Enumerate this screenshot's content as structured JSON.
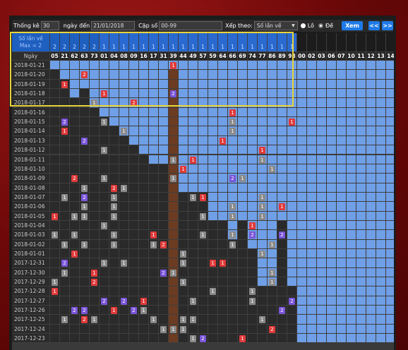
{
  "toolbar": {
    "thong_ke_label": "Thống kê",
    "thong_ke_value": "30",
    "ngay_den_label": "ngày đến",
    "ngay_den_value": "21/01/2018",
    "cap_so_label": "Cặp số",
    "cap_so_value": "00-99",
    "xep_theo_label": "Xếp theo:",
    "xep_theo_value": "Số lần về",
    "lo_label": "Lô",
    "de_label": "Đề",
    "xem_label": "Xem",
    "prev_label": "<<",
    "next_label": ">>"
  },
  "header": {
    "so_lan_ve": "Số lần về",
    "max": "Max = 2",
    "ngay": "Ngày"
  },
  "numbers": [
    "05",
    "21",
    "62",
    "63",
    "73",
    "01",
    "04",
    "08",
    "09",
    "16",
    "17",
    "31",
    "39",
    "44",
    "49",
    "57",
    "59",
    "64",
    "66",
    "69",
    "74",
    "77",
    "86",
    "89",
    "98",
    "00",
    "02",
    "03",
    "06",
    "07",
    "10",
    "11",
    "12",
    "13",
    "14"
  ],
  "counts": [
    "2",
    "2",
    "2",
    "2",
    "2",
    "1",
    "1",
    "1",
    "1",
    "1",
    "1",
    "1",
    "1",
    "1",
    "1",
    "1",
    "1",
    "1",
    "1",
    "1",
    "1",
    "1",
    "1",
    "1",
    "1",
    "",
    "",
    "",
    "",
    "",
    "",
    "",
    "",
    "",
    ""
  ],
  "dates": [
    "2018-01-21",
    "2018-01-20",
    "2018-01-19",
    "2018-01-18",
    "2018-01-17",
    "2018-01-16",
    "2018-01-15",
    "2018-01-14",
    "2018-01-13",
    "2018-01-12",
    "2018-01-11",
    "2018-01-10",
    "2018-01-09",
    "2018-01-08",
    "2018-01-07",
    "2018-01-06",
    "2018-01-05",
    "2018-01-04",
    "2018-01-03",
    "2018-01-02",
    "2018-01-01",
    "2017-12-31",
    "2017-12-30",
    "2017-12-29",
    "2017-12-28",
    "2017-12-27",
    "2017-12-26",
    "2017-12-25",
    "2017-12-24",
    "2017-12-23"
  ],
  "dark_from": [
    1,
    2,
    4,
    3,
    5,
    6,
    7,
    8,
    9,
    10,
    11,
    11,
    1,
    14,
    14,
    14,
    17,
    17,
    19,
    17,
    20,
    24,
    24,
    17,
    24,
    30,
    30,
    30,
    30,
    30,
    30,
    30,
    30,
    30,
    30
  ],
  "marks": [
    [
      0,
      12,
      "1",
      "r"
    ],
    [
      1,
      3,
      "2",
      "r"
    ],
    [
      2,
      1,
      "1",
      "r"
    ],
    [
      3,
      5,
      "1",
      "r"
    ],
    [
      3,
      12,
      "2",
      "p"
    ],
    [
      4,
      4,
      "1",
      "g"
    ],
    [
      4,
      8,
      "2",
      "r"
    ],
    [
      5,
      18,
      "1",
      "r"
    ],
    [
      6,
      1,
      "2",
      "p"
    ],
    [
      6,
      5,
      "1",
      "g"
    ],
    [
      6,
      18,
      "1",
      "g"
    ],
    [
      6,
      24,
      "1",
      "r"
    ],
    [
      7,
      1,
      "1",
      "r"
    ],
    [
      7,
      7,
      "1",
      "g"
    ],
    [
      7,
      18,
      "1",
      "g"
    ],
    [
      8,
      3,
      "2",
      "p"
    ],
    [
      8,
      17,
      "1",
      "r"
    ],
    [
      9,
      5,
      "1",
      "g"
    ],
    [
      9,
      21,
      "1",
      "r"
    ],
    [
      10,
      12,
      "1",
      "g"
    ],
    [
      10,
      14,
      "1",
      "r"
    ],
    [
      10,
      21,
      "1",
      "g"
    ],
    [
      11,
      13,
      "1",
      "r"
    ],
    [
      11,
      22,
      "1",
      "g"
    ],
    [
      12,
      2,
      "2",
      "r"
    ],
    [
      12,
      5,
      "1",
      "g"
    ],
    [
      12,
      12,
      "1",
      "g"
    ],
    [
      12,
      18,
      "2",
      "p"
    ],
    [
      12,
      19,
      "1",
      "g"
    ],
    [
      13,
      3,
      "1",
      "g"
    ],
    [
      13,
      6,
      "2",
      "r"
    ],
    [
      13,
      7,
      "1",
      "g"
    ],
    [
      14,
      1,
      "1",
      "g"
    ],
    [
      14,
      3,
      "2",
      "p"
    ],
    [
      14,
      6,
      "1",
      "g"
    ],
    [
      14,
      14,
      "1",
      "g"
    ],
    [
      14,
      15,
      "1",
      "r"
    ],
    [
      14,
      21,
      "1",
      "g"
    ],
    [
      15,
      3,
      "1",
      "g"
    ],
    [
      15,
      6,
      "1",
      "g"
    ],
    [
      15,
      18,
      "1",
      "g"
    ],
    [
      15,
      21,
      "1",
      "g"
    ],
    [
      15,
      23,
      "1",
      "r"
    ],
    [
      16,
      0,
      "1",
      "r"
    ],
    [
      16,
      2,
      "1",
      "g"
    ],
    [
      16,
      3,
      "1",
      "g"
    ],
    [
      16,
      6,
      "1",
      "g"
    ],
    [
      16,
      15,
      "1",
      "g"
    ],
    [
      16,
      18,
      "1",
      "g"
    ],
    [
      16,
      21,
      "1",
      "g"
    ],
    [
      17,
      5,
      "1",
      "g"
    ],
    [
      17,
      20,
      "1",
      "r"
    ],
    [
      18,
      0,
      "1",
      "g"
    ],
    [
      18,
      2,
      "1",
      "g"
    ],
    [
      18,
      6,
      "1",
      "g"
    ],
    [
      18,
      10,
      "1",
      "r"
    ],
    [
      18,
      15,
      "1",
      "g"
    ],
    [
      18,
      18,
      "1",
      "g"
    ],
    [
      18,
      20,
      "2",
      "p"
    ],
    [
      18,
      23,
      "2",
      "p"
    ],
    [
      19,
      1,
      "1",
      "g"
    ],
    [
      19,
      3,
      "1",
      "g"
    ],
    [
      19,
      6,
      "1",
      "g"
    ],
    [
      19,
      10,
      "1",
      "g"
    ],
    [
      19,
      11,
      "2",
      "r"
    ],
    [
      19,
      18,
      "1",
      "g"
    ],
    [
      19,
      22,
      "1",
      "g"
    ],
    [
      20,
      2,
      "1",
      "r"
    ],
    [
      20,
      13,
      "1",
      "g"
    ],
    [
      20,
      21,
      "1",
      "g"
    ],
    [
      21,
      1,
      "2",
      "p"
    ],
    [
      21,
      5,
      "1",
      "g"
    ],
    [
      21,
      7,
      "1",
      "g"
    ],
    [
      21,
      13,
      "1",
      "g"
    ],
    [
      21,
      16,
      "1",
      "r"
    ],
    [
      21,
      17,
      "1",
      "r"
    ],
    [
      22,
      1,
      "1",
      "g"
    ],
    [
      22,
      4,
      "1",
      "r"
    ],
    [
      22,
      11,
      "2",
      "p"
    ],
    [
      22,
      12,
      "1",
      "g"
    ],
    [
      22,
      22,
      "1",
      "g"
    ],
    [
      23,
      0,
      "1",
      "g"
    ],
    [
      23,
      4,
      "2",
      "r"
    ],
    [
      23,
      13,
      "1",
      "g"
    ],
    [
      23,
      22,
      "1",
      "g"
    ],
    [
      24,
      0,
      "1",
      "r"
    ],
    [
      24,
      16,
      "1",
      "g"
    ],
    [
      24,
      20,
      "1",
      "g"
    ],
    [
      25,
      5,
      "2",
      "p"
    ],
    [
      25,
      7,
      "2",
      "p"
    ],
    [
      25,
      9,
      "1",
      "r"
    ],
    [
      25,
      14,
      "1",
      "g"
    ],
    [
      25,
      20,
      "1",
      "g"
    ],
    [
      25,
      24,
      "2",
      "p"
    ],
    [
      26,
      2,
      "2",
      "p"
    ],
    [
      26,
      3,
      "2",
      "p"
    ],
    [
      26,
      6,
      "1",
      "r"
    ],
    [
      26,
      8,
      "2",
      "p"
    ],
    [
      26,
      9,
      "1",
      "g"
    ],
    [
      26,
      23,
      "2",
      "p"
    ],
    [
      27,
      1,
      "1",
      "g"
    ],
    [
      27,
      3,
      "2",
      "r"
    ],
    [
      27,
      4,
      "1",
      "g"
    ],
    [
      27,
      10,
      "1",
      "g"
    ],
    [
      27,
      13,
      "1",
      "g"
    ],
    [
      27,
      14,
      "1",
      "g"
    ],
    [
      27,
      21,
      "1",
      "g"
    ],
    [
      28,
      11,
      "1",
      "g"
    ],
    [
      28,
      12,
      "1",
      "g"
    ],
    [
      28,
      13,
      "1",
      "g"
    ],
    [
      28,
      22,
      "2",
      "r"
    ],
    [
      29,
      14,
      "1",
      "g"
    ],
    [
      29,
      15,
      "2",
      "p"
    ],
    [
      29,
      19,
      "1",
      "r"
    ]
  ],
  "colors": {
    "blue": "#6f9fe6",
    "dark": "#2a2a2a",
    "brown": "#6b3b22",
    "red": "#e03a3a",
    "purple": "#7a55d8",
    "gray": "#8a8a8a",
    "accent": "#1f7ae8",
    "highlight": "#e8d43b"
  }
}
